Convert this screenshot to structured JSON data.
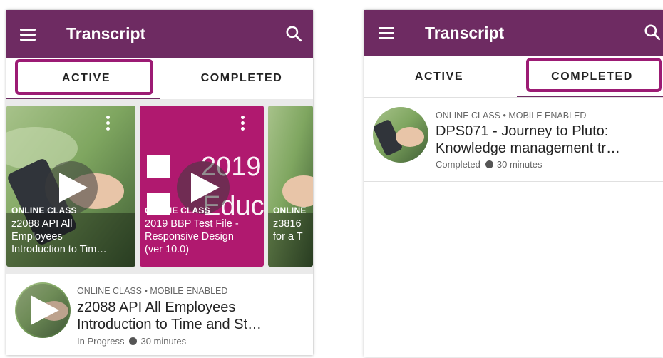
{
  "left_screen": {
    "title": "Transcript",
    "tabs": [
      "ACTIVE",
      "COMPLETED"
    ],
    "selected_tab": "ACTIVE",
    "cards": [
      {
        "type": "ONLINE CLASS",
        "title_lines": [
          "z2088 API All",
          "Employees",
          "Introduction to Tim…"
        ]
      },
      {
        "type": "ONLINE CLASS",
        "title_lines": [
          "2019 BBP Test File -",
          "Responsive Design",
          "(ver 10.0)"
        ],
        "bg_text_line1": "2019",
        "bg_text_line2": "Educa"
      },
      {
        "type": "ONLINE",
        "title_lines": [
          "z3816",
          "for a T"
        ]
      }
    ],
    "list_item": {
      "meta": "ONLINE CLASS • MOBILE ENABLED",
      "title_lines": [
        "z2088 API All Employees",
        "Introduction to Time and St…"
      ],
      "status": "In Progress",
      "duration": "30 minutes"
    }
  },
  "right_screen": {
    "title": "Transcript",
    "tabs": [
      "ACTIVE",
      "COMPLETED"
    ],
    "selected_tab": "COMPLETED",
    "list_item": {
      "meta": "ONLINE CLASS • MOBILE ENABLED",
      "title_lines": [
        "DPS071 - Journey to Pluto:",
        "Knowledge management tr…"
      ],
      "status": "Completed",
      "duration": "30 minutes"
    }
  },
  "colors": {
    "brand": "#6e2b62",
    "highlight": "#9c1b74",
    "card_magenta": "#b0196f"
  },
  "icons": [
    "menu-icon",
    "search-icon",
    "more-vert-icon",
    "play-icon",
    "status-dot-icon"
  ]
}
